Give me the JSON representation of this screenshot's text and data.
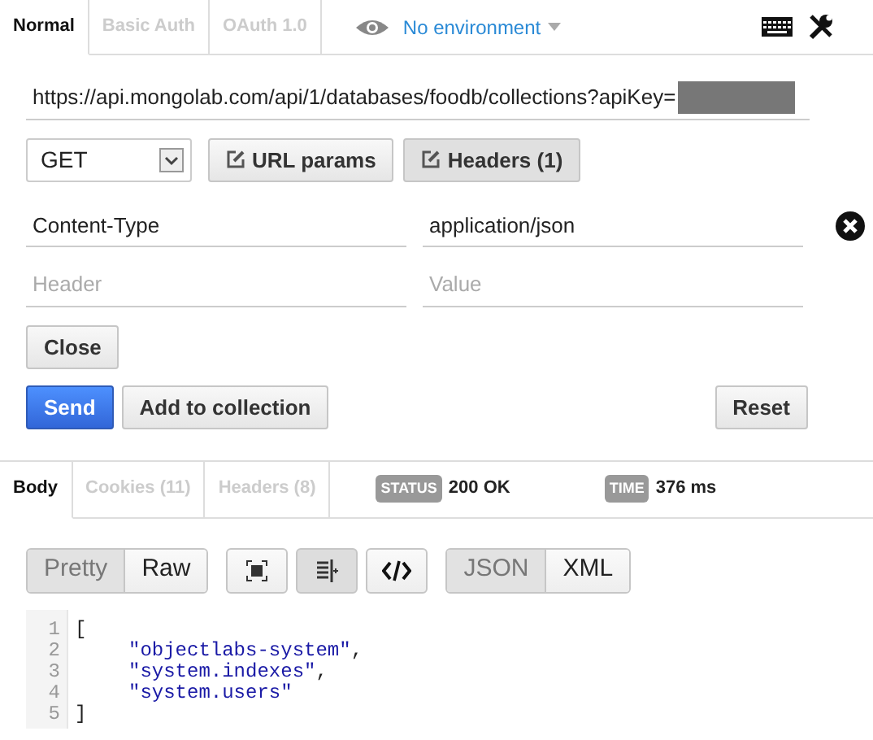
{
  "auth_tabs": [
    {
      "label": "Normal",
      "selected": true
    },
    {
      "label": "Basic Auth",
      "selected": false
    },
    {
      "label": "OAuth 1.0",
      "selected": false
    }
  ],
  "environment": {
    "label": "No environment"
  },
  "url": {
    "value": "https://api.mongolab.com/api/1/databases/foodb/collections?apiKey="
  },
  "method": {
    "value": "GET"
  },
  "request_buttons": [
    {
      "label": "URL params",
      "selected": false
    },
    {
      "label": "Headers (1)",
      "selected": true
    }
  ],
  "headers": [
    {
      "key": "Content-Type",
      "value": "application/json",
      "removable": true
    },
    {
      "key_placeholder": "Header",
      "value_placeholder": "Value",
      "removable": false
    }
  ],
  "close_button": "Close",
  "actions": {
    "send": "Send",
    "add": "Add to collection",
    "reset": "Reset"
  },
  "response_tabs": [
    {
      "label": "Body",
      "selected": true
    },
    {
      "label": "Cookies (11)",
      "selected": false
    },
    {
      "label": "Headers (8)",
      "selected": false
    }
  ],
  "status": {
    "badge": "STATUS",
    "value": "200 OK"
  },
  "time": {
    "badge": "TIME",
    "value": "376 ms"
  },
  "view_modes": [
    {
      "label": "Pretty",
      "selected": true
    },
    {
      "label": "Raw",
      "selected": false
    }
  ],
  "tool_buttons": [
    {
      "kind": "fullscreen",
      "selected": false
    },
    {
      "kind": "wrap",
      "selected": true
    },
    {
      "kind": "code",
      "selected": false
    }
  ],
  "formats": [
    {
      "label": "JSON",
      "selected": true
    },
    {
      "label": "XML",
      "selected": false
    }
  ],
  "code_lines": [
    {
      "number": "1",
      "indent": false,
      "tokens": [
        {
          "text": "[",
          "kind": "punct"
        }
      ]
    },
    {
      "number": "2",
      "indent": true,
      "tokens": [
        {
          "text": "\"objectlabs-system\"",
          "kind": "string"
        },
        {
          "text": ",",
          "kind": "punct"
        }
      ]
    },
    {
      "number": "3",
      "indent": true,
      "tokens": [
        {
          "text": "\"system.indexes\"",
          "kind": "string"
        },
        {
          "text": ",",
          "kind": "punct"
        }
      ]
    },
    {
      "number": "4",
      "indent": true,
      "tokens": [
        {
          "text": "\"system.users\"",
          "kind": "string"
        }
      ]
    },
    {
      "number": "5",
      "indent": false,
      "tokens": [
        {
          "text": "]",
          "kind": "punct"
        }
      ]
    }
  ]
}
